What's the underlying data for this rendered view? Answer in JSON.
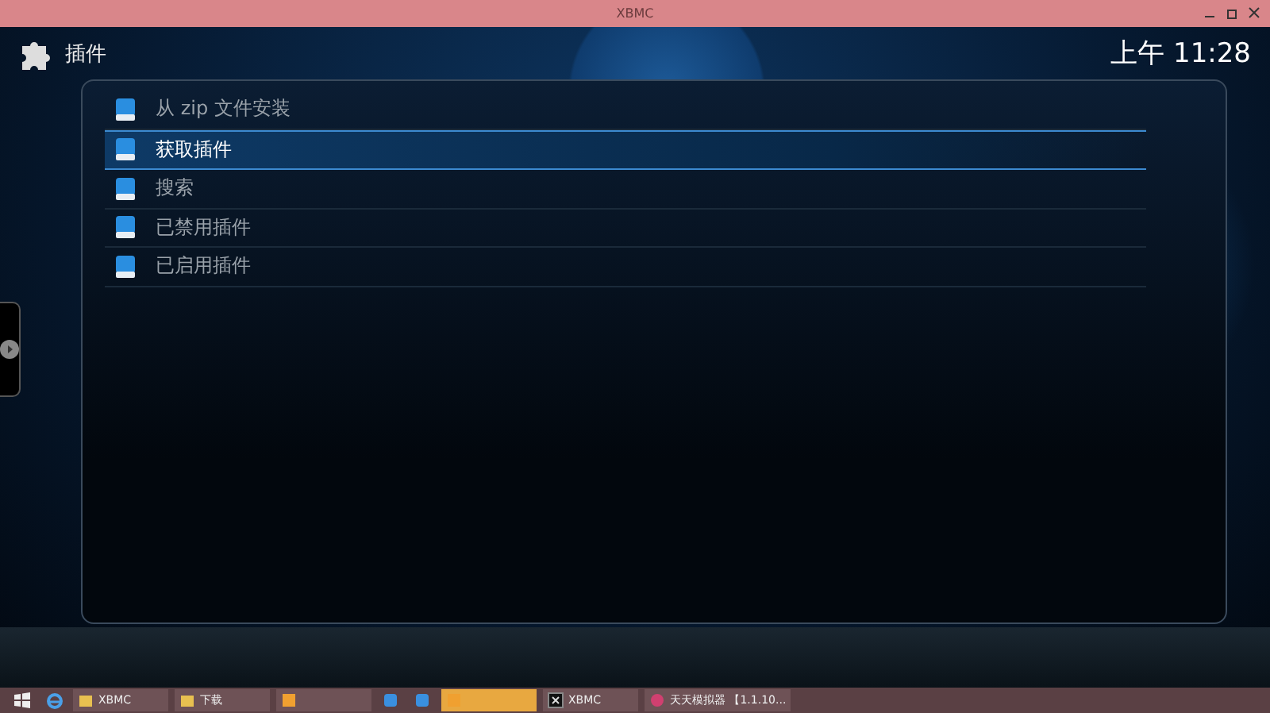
{
  "window": {
    "title": "XBMC"
  },
  "header": {
    "title": "插件",
    "clock": "上午 11:28"
  },
  "menu": [
    {
      "label": "从 zip 文件安装",
      "selected": false
    },
    {
      "label": "获取插件",
      "selected": true
    },
    {
      "label": "搜索",
      "selected": false
    },
    {
      "label": "已禁用插件",
      "selected": false
    },
    {
      "label": "已启用插件",
      "selected": false
    }
  ],
  "taskbar": [
    {
      "kind": "start"
    },
    {
      "kind": "browser"
    },
    {
      "kind": "folder",
      "label": "XBMC",
      "active": false
    },
    {
      "kind": "folder",
      "label": "下载",
      "active": false
    },
    {
      "kind": "app",
      "active": false
    },
    {
      "kind": "small"
    },
    {
      "kind": "small"
    },
    {
      "kind": "app",
      "active": true
    },
    {
      "kind": "xbmc",
      "label": "XBMC",
      "active": false
    },
    {
      "kind": "emulator",
      "label": "天天模拟器 【1.1.10...",
      "active": false
    }
  ]
}
